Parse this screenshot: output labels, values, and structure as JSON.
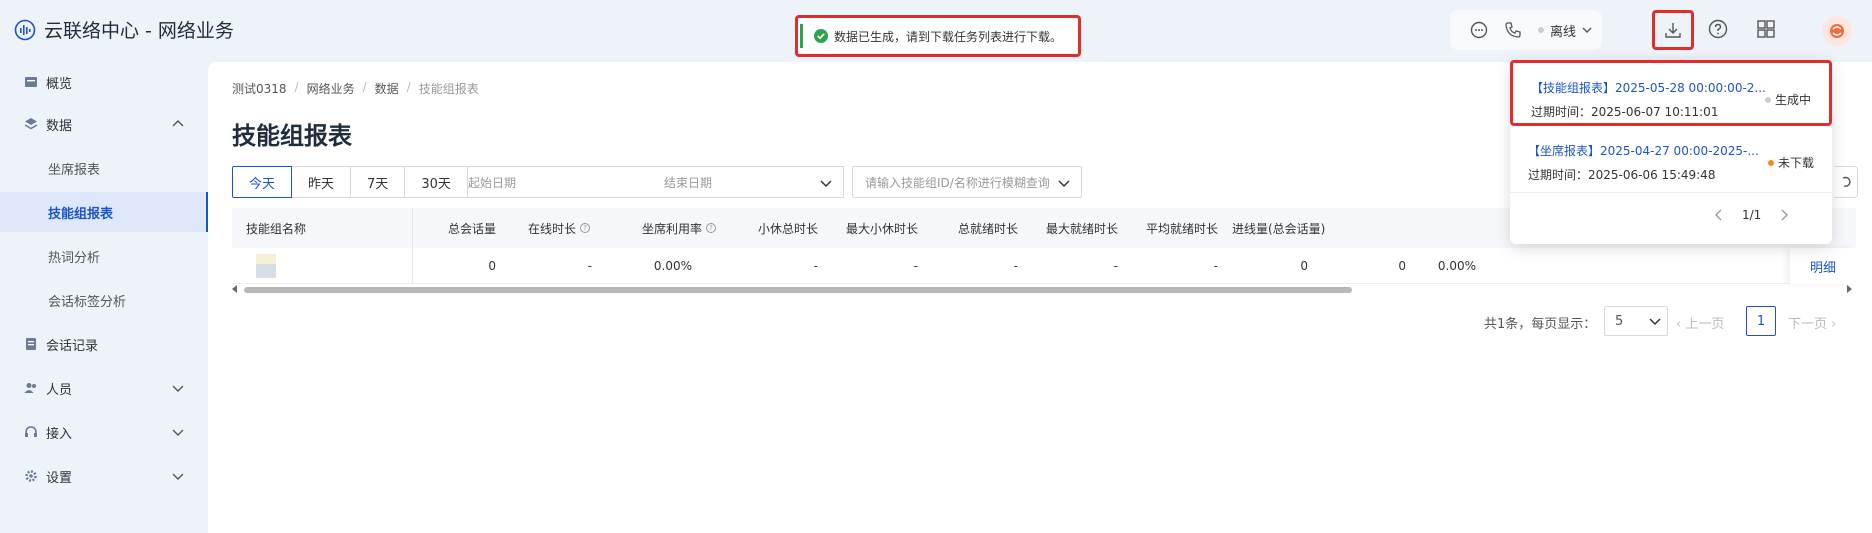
{
  "app": {
    "title": "云联络中心 - 网络业务"
  },
  "header": {
    "status_label": "离线"
  },
  "toast": {
    "message": "数据已生成，请到下载任务列表进行下载。"
  },
  "sidebar": {
    "items": [
      {
        "label": "概览"
      },
      {
        "label": "数据"
      },
      {
        "label": "坐席报表"
      },
      {
        "label": "技能组报表"
      },
      {
        "label": "热词分析"
      },
      {
        "label": "会话标签分析"
      },
      {
        "label": "会话记录"
      },
      {
        "label": "人员"
      },
      {
        "label": "接入"
      },
      {
        "label": "设置"
      }
    ]
  },
  "breadcrumb": [
    "测试0318",
    "网络业务",
    "数据",
    "技能组报表"
  ],
  "page_title": "技能组报表",
  "filters": {
    "ranges": [
      "今天",
      "昨天",
      "7天",
      "30天"
    ],
    "start_placeholder": "起始日期",
    "end_placeholder": "结束日期",
    "search_placeholder": "请输入技能组ID/名称进行模糊查询"
  },
  "table": {
    "headers": [
      "技能组名称",
      "总会话量",
      "在线时长",
      "坐席利用率",
      "小休总时长",
      "最大小休时长",
      "总就绪时长",
      "最大就绪时长",
      "平均就绪时长",
      "进线量(总会话量)"
    ],
    "row": [
      "0",
      "-",
      "0.00%",
      "-",
      "-",
      "-",
      "-",
      "-",
      "0",
      "0",
      "0.00%"
    ],
    "detail_label": "明细"
  },
  "pagination": {
    "total_label": "共1条，每页显示：",
    "page_size": "5",
    "prev_label": "上一页",
    "current_page": "1",
    "next_label": "下一页"
  },
  "downloads": {
    "items": [
      {
        "name": "【技能组报表】2025-05-28 00:00:00-2...",
        "expire": "过期时间：2025-06-07 10:11:01",
        "status": "生成中",
        "status_color": "#cccccc"
      },
      {
        "name": "【坐席报表】2025-04-27 00:00-2025-...",
        "expire": "过期时间：2025-06-06 15:49:48",
        "status": "未下载",
        "status_color": "#fa8c16"
      }
    ],
    "page": "1/1"
  },
  "colors": {
    "primary": "#1a55c8",
    "highlight_border": "#e02d2d",
    "success": "#2ea44f"
  }
}
